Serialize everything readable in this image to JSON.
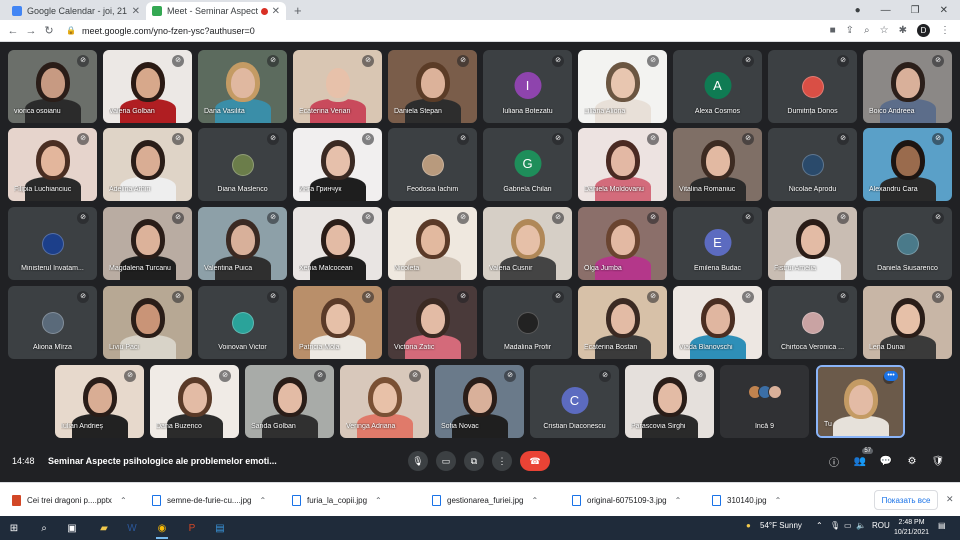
{
  "browser": {
    "tabs": [
      {
        "title": "Google Calendar - joi, 21 octombrie",
        "favicon": "calendar-icon",
        "active": false
      },
      {
        "title": "Meet - Seminar Aspecte psih...",
        "favicon": "meet-icon",
        "active": true
      }
    ],
    "url": "meet.google.com/yno-fzen-ysc?authuser=0",
    "profile_initial": "D"
  },
  "participants": [
    {
      "name": "viorica osoianu",
      "kind": "video",
      "bg": "#6b6f6a",
      "skin": "#c79a82",
      "hair": "#2a1d18",
      "shirt": "#2b2b2b"
    },
    {
      "name": "Valeria Golban",
      "kind": "video",
      "bg": "#ece8e5",
      "skin": "#d7a88b",
      "hair": "#2a1a14",
      "shirt": "#b01e22"
    },
    {
      "name": "Dana Vasilita",
      "kind": "video",
      "bg": "#5c6b5e",
      "skin": "#e0b8a0",
      "hair": "#c49b64",
      "shirt": "#3a8ea8"
    },
    {
      "name": "Ecaterina Verian",
      "kind": "video",
      "bg": "#d9c6b3",
      "skin": "#e7c1aa",
      "hair": "#d9c6b3",
      "shirt": "#c94a5c"
    },
    {
      "name": "Daniela Stepan",
      "kind": "video",
      "bg": "#7a5d4a",
      "skin": "#dcb29a",
      "hair": "#5b3c27",
      "shirt": "#2d2d2d"
    },
    {
      "name": "Iuliana Botezatu",
      "kind": "avatar",
      "letter": "I",
      "color": "#8e44ad"
    },
    {
      "name": "Liliana Aliona",
      "kind": "video",
      "bg": "#f3f3f1",
      "skin": "#e8c6b0",
      "hair": "#6b5642",
      "shirt": "#e8e0d8"
    },
    {
      "name": "Alexa Cosmos",
      "kind": "avatar",
      "letter": "A",
      "color": "#0f7b53"
    },
    {
      "name": "Dumitrița Donos",
      "kind": "photo-avatar",
      "color": "#d94f45"
    },
    {
      "name": "Boico Andreea",
      "kind": "video",
      "bg": "#8b8886",
      "skin": "#d9b09a",
      "hair": "#2b1f1a",
      "shirt": "#5c6d8a"
    },
    {
      "name": "Filipia Luchianciuc",
      "kind": "video",
      "bg": "#e6d4cc",
      "skin": "#e3b69c",
      "hair": "#4a2e22",
      "shirt": "#2a2a2a"
    },
    {
      "name": "Adelina Arhiri",
      "kind": "video",
      "bg": "#dfd4c7",
      "skin": "#d9ad94",
      "hair": "#2a1d18",
      "shirt": "#eeeeee"
    },
    {
      "name": "Diana Maslenco",
      "kind": "photo-avatar",
      "color": "#6b7d4a"
    },
    {
      "name": "Инга Гринчук",
      "kind": "video",
      "bg": "#f1efef",
      "skin": "#e6c0ab",
      "hair": "#3b2a23",
      "shirt": "#1e1e1e"
    },
    {
      "name": "Feodosia Iachim",
      "kind": "photo-avatar",
      "color": "#b89a7d"
    },
    {
      "name": "Gabriela Chilari",
      "kind": "avatar",
      "letter": "G",
      "color": "#1e8e5a"
    },
    {
      "name": "Daniela Moldovanu",
      "kind": "video",
      "bg": "#ede3e1",
      "skin": "#e3b8a4",
      "hair": "#4a2a22",
      "shirt": "#d36b7b"
    },
    {
      "name": "Vitalina Romaniuc",
      "kind": "video",
      "bg": "#7f6f66",
      "skin": "#e2b9a2",
      "hair": "#3d2b22",
      "shirt": "#2b2b2b"
    },
    {
      "name": "Nicolae Aprodu",
      "kind": "photo-avatar",
      "color": "#2a4a6b"
    },
    {
      "name": "Alexandru Cara",
      "kind": "video",
      "bg": "#5aa0c8",
      "skin": "#9a6b4d",
      "hair": "#1d1512",
      "shirt": "#2a2a2a"
    },
    {
      "name": "Ministerul Invatam...",
      "kind": "photo-avatar",
      "color": "#1c3f8a"
    },
    {
      "name": "Magdalena Turcanu",
      "kind": "video",
      "bg": "#b9aca2",
      "skin": "#dcb29a",
      "hair": "#2a1d18",
      "shirt": "#1f1f1f"
    },
    {
      "name": "Valentina Puica",
      "kind": "video",
      "bg": "#8da0a8",
      "skin": "#d8b09a",
      "hair": "#3b2a23",
      "shirt": "#2f2f2f"
    },
    {
      "name": "Xenia Malcocean",
      "kind": "video",
      "bg": "#e9e5e3",
      "skin": "#e3bba5",
      "hair": "#2a1d18",
      "shirt": "#1e1e1e"
    },
    {
      "name": "Nicoleta",
      "kind": "video",
      "bg": "#efe8df",
      "skin": "#e2b99f",
      "hair": "#5a3a28",
      "shirt": "#cfc2b5"
    },
    {
      "name": "Valeria Cusnir",
      "kind": "video",
      "bg": "#d6cfc6",
      "skin": "#e6c0a8",
      "hair": "#b08858",
      "shirt": "#444444"
    },
    {
      "name": "Olga Jumba",
      "kind": "video",
      "bg": "#8b6f6a",
      "skin": "#e3b9a3",
      "hair": "#6a4430",
      "shirt": "#b4378a"
    },
    {
      "name": "Emilena Budac",
      "kind": "avatar",
      "letter": "E",
      "color": "#5c6bc0"
    },
    {
      "name": "Fistrui Amelia",
      "kind": "video",
      "bg": "#c9bdb3",
      "skin": "#e3bba5",
      "hair": "#2a1d18",
      "shirt": "#efefef"
    },
    {
      "name": "Daniela Siusarenco",
      "kind": "photo-avatar",
      "color": "#4a7a8a"
    },
    {
      "name": "Aliona Mîrza",
      "kind": "photo-avatar",
      "color": "#5a6a7a"
    },
    {
      "name": "Liviu Paci",
      "kind": "video",
      "bg": "#b7a894",
      "skin": "#c99477",
      "hair": "#2a1d18",
      "shirt": "#d8d3c8"
    },
    {
      "name": "Voinovan Victor",
      "kind": "photo-avatar",
      "color": "#2aa39a"
    },
    {
      "name": "Patricia Mola",
      "kind": "video",
      "bg": "#b98f6a",
      "skin": "#e6c0a8",
      "hair": "#5a3a28",
      "shirt": "#ece8e2"
    },
    {
      "name": "Victoria Zatic",
      "kind": "video",
      "bg": "#4a3a3a",
      "skin": "#e3bba5",
      "hair": "#3b2a23",
      "shirt": "#d46a7a"
    },
    {
      "name": "Madalina Profir",
      "kind": "photo-avatar",
      "color": "#222222"
    },
    {
      "name": "Ecaterina Bostan",
      "kind": "video",
      "bg": "#d7c1a8",
      "skin": "#e3bba5",
      "hair": "#3b2a23",
      "shirt": "#3b3b3b"
    },
    {
      "name": "Viada Blanovschi",
      "kind": "video",
      "bg": "#ede7e2",
      "skin": "#e0b6a0",
      "hair": "#4a2e22",
      "shirt": "#2e8fb8"
    },
    {
      "name": "Chirtoca Veronica ...",
      "kind": "photo-avatar",
      "color": "#c9a3a3"
    },
    {
      "name": "Lena Dunai",
      "kind": "video",
      "bg": "#c8b6a6",
      "skin": "#e6c0a8",
      "hair": "#2a1d18",
      "shirt": "#3a3a3a"
    },
    {
      "name": "Iulian Andrieș",
      "kind": "video",
      "bg": "#e7d9cc",
      "skin": "#d9ad94",
      "hair": "#2a1d18",
      "shirt": "#222222"
    },
    {
      "name": "Dana Buzenco",
      "kind": "video",
      "bg": "#f0ebe6",
      "skin": "#e3bba5",
      "hair": "#5a3a28",
      "shirt": "#2b2b2b"
    },
    {
      "name": "Sanda Golban",
      "kind": "video",
      "bg": "#a8aba8",
      "skin": "#e3bba5",
      "hair": "#2a1d18",
      "shirt": "#303030"
    },
    {
      "name": "Veringa Adriana",
      "kind": "video",
      "bg": "#d8c8bb",
      "skin": "#e8c1a8",
      "hair": "#7a5034",
      "shirt": "#e07a6a"
    },
    {
      "name": "Sofia Novac",
      "kind": "video",
      "bg": "#6a7a8a",
      "skin": "#d9b09a",
      "hair": "#2a1d18",
      "shirt": "#1f1f1f"
    },
    {
      "name": "Cristian Diaconescu",
      "kind": "avatar",
      "letter": "C",
      "color": "#5c6bc0"
    },
    {
      "name": "Parascovia Sirghi",
      "kind": "video",
      "bg": "#e5e0dc",
      "skin": "#e3bba5",
      "hair": "#2a1d18",
      "shirt": "#2a2a2a"
    },
    {
      "name": "Încă 9",
      "kind": "more"
    },
    {
      "name": "Tu",
      "kind": "self",
      "bg": "#6b5a4a",
      "skin": "#e3bba5",
      "hair": "#c49b64",
      "shirt": "#e6e1da"
    }
  ],
  "controls": {
    "time": "14:48",
    "meeting_title": "Seminar Aspecte psihologice ale problemelor emoti...",
    "participant_count": "57"
  },
  "downloads": [
    {
      "name": "Cei trei dragoni p....pptx",
      "type": "ppt"
    },
    {
      "name": "semne-de-furie-cu....jpg",
      "type": "img"
    },
    {
      "name": "furia_la_copii.jpg",
      "type": "img"
    },
    {
      "name": "gestionarea_furiei.jpg",
      "type": "img"
    },
    {
      "name": "original-6075109-3.jpg",
      "type": "img"
    },
    {
      "name": "310140.jpg",
      "type": "img"
    }
  ],
  "shelf": {
    "show_all": "Показать все"
  },
  "taskbar": {
    "weather": "54°F  Sunny",
    "lang": "ROU",
    "time": "2:48 PM",
    "date": "10/21/2021"
  }
}
